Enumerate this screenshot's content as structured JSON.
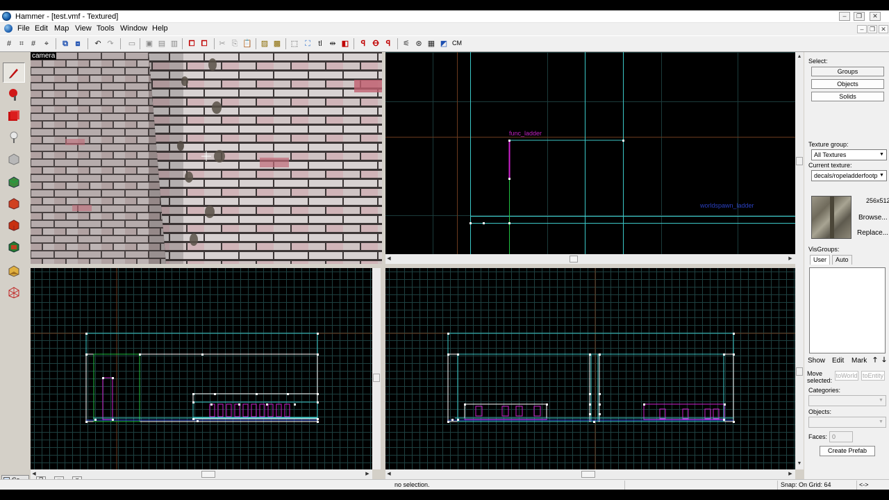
{
  "window": {
    "title": "Hammer - [test.vmf - Textured]",
    "controls": [
      "–",
      "❐",
      "✕"
    ],
    "mdi_controls": [
      "–",
      "❐",
      "✕"
    ]
  },
  "menu": [
    "File",
    "Edit",
    "Map",
    "View",
    "Tools",
    "Window",
    "Help"
  ],
  "toolbar": {
    "cm_label": "CM"
  },
  "viewports": {
    "camera_label": "camera",
    "top_labels": {
      "entity": "func_ladder",
      "other": "worldspawn_ladder"
    }
  },
  "right_panel": {
    "select_label": "Select:",
    "select_buttons": [
      "Groups",
      "Objects",
      "Solids"
    ],
    "texture_group_label": "Texture group:",
    "texture_group_value": "All Textures",
    "current_texture_label": "Current texture:",
    "current_texture_value": "decals/ropeladderfootp",
    "texture_size": "256x512",
    "browse_label": "Browse...",
    "replace_label": "Replace...",
    "visgroups_label": "VisGroups:",
    "visgroup_tabs": [
      "User",
      "Auto"
    ],
    "vis_actions": [
      "Show",
      "Edit",
      "Mark"
    ],
    "move_selected_label": "Move selected:",
    "to_world": "toWorld",
    "to_entity": "toEntity",
    "categories_label": "Categories:",
    "objects_label": "Objects:",
    "faces_label": "Faces:",
    "faces_value": "0",
    "create_prefab": "Create Prefab"
  },
  "status": {
    "selection": "no selection.",
    "snap": "Snap: On Grid: 64",
    "last": "<->"
  },
  "taskbar": {
    "item": "Co..."
  },
  "colors": {
    "grid_line": "#1e4040",
    "grid_axis": "#6a3a1e",
    "brush_cyan": "#3cc8c8",
    "brush_white": "#ffffff",
    "brush_magenta": "#d020d0",
    "brush_green": "#20c040",
    "brush_blue": "#3050e0"
  }
}
